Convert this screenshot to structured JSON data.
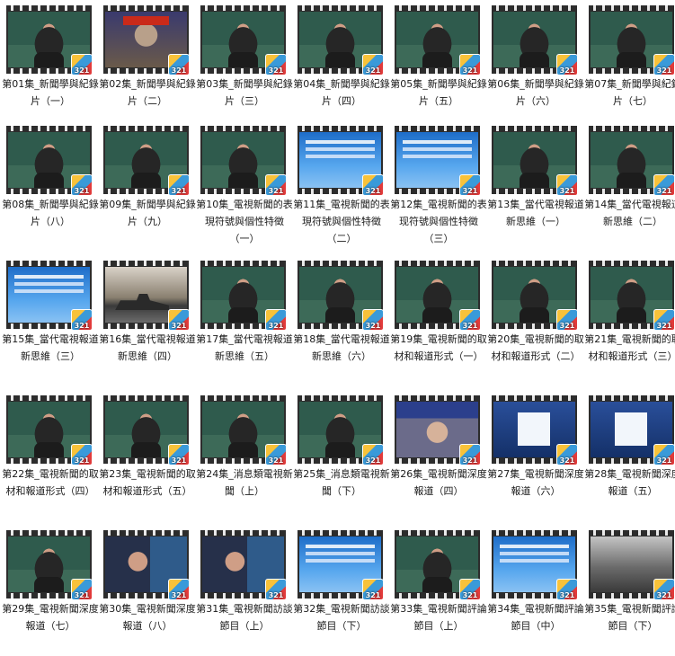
{
  "badge_text": "321",
  "items": [
    {
      "label": "第01集_新聞學與紀錄片（一）",
      "thumb": "lecture"
    },
    {
      "label": "第02集_新聞學與紀錄片（二）",
      "thumb": "book"
    },
    {
      "label": "第03集_新聞學與紀錄片（三）",
      "thumb": "lecture"
    },
    {
      "label": "第04集_新聞學與紀錄片（四）",
      "thumb": "lecture"
    },
    {
      "label": "第05集_新聞學與紀錄片（五）",
      "thumb": "lecture"
    },
    {
      "label": "第06集_新聞學與紀錄片（六）",
      "thumb": "lecture"
    },
    {
      "label": "第07集_新聞學與紀錄片（七）",
      "thumb": "lecture"
    },
    {
      "label": "第08集_新聞學與紀錄片（八）",
      "thumb": "lecture"
    },
    {
      "label": "第09集_新聞學與紀錄片（九）",
      "thumb": "lecture"
    },
    {
      "label": "第10集_電視新聞的表現符號與個性特徵（一）",
      "thumb": "lecture"
    },
    {
      "label": "第11集_電視新聞的表現符號與個性特徵（二）",
      "thumb": "blue"
    },
    {
      "label": "第12集_電視新聞的表现符號與個性特徵（三）",
      "thumb": "blue"
    },
    {
      "label": "第13集_當代電視報道新思維（一）",
      "thumb": "lecture"
    },
    {
      "label": "第14集_當代電視報道新思維（二）",
      "thumb": "lecture"
    },
    {
      "label": "第15集_當代電視報道新思維（三）",
      "thumb": "blue"
    },
    {
      "label": "第16集_當代電視報道新思維（四）",
      "thumb": "ship"
    },
    {
      "label": "第17集_當代電視報道新思維（五）",
      "thumb": "lecture"
    },
    {
      "label": "第18集_當代電視報道新思維（六）",
      "thumb": "lecture"
    },
    {
      "label": "第19集_電視新聞的取材和報道形式（一）",
      "thumb": "lecture"
    },
    {
      "label": "第20集_電視新聞的取材和報道形式（二）",
      "thumb": "lecture"
    },
    {
      "label": "第21集_電視新聞的取材和報道形式（三）",
      "thumb": "lecture"
    },
    {
      "label": "第22集_電視新聞的取材和報道形式（四）",
      "thumb": "lecture"
    },
    {
      "label": "第23集_電視新聞的取材和報道形式（五）",
      "thumb": "lecture"
    },
    {
      "label": "第24集_消息類電視新聞（上）",
      "thumb": "lecture"
    },
    {
      "label": "第25集_消息類電視新聞（下）",
      "thumb": "lecture"
    },
    {
      "label": "第26集_電視新聞深度報道（四）",
      "thumb": "news"
    },
    {
      "label": "第27集_電視新聞深度報道（六）",
      "thumb": "screen"
    },
    {
      "label": "第28集_電視新聞深度報道（五）",
      "thumb": "screen"
    },
    {
      "label": "第29集_電視新聞深度報道（七）",
      "thumb": "lecture"
    },
    {
      "label": "第30集_電視新聞深度報道（八）",
      "thumb": "talk"
    },
    {
      "label": "第31集_電視新聞訪談節目（上）",
      "thumb": "talk"
    },
    {
      "label": "第32集_電視新聞訪談節目（下）",
      "thumb": "blue"
    },
    {
      "label": "第33集_電視新聞評論節目（上）",
      "thumb": "lecture"
    },
    {
      "label": "第34集_電視新聞評論節目（中）",
      "thumb": "blue"
    },
    {
      "label": "第35集_電視新聞評論節目（下）",
      "thumb": "aerial"
    }
  ]
}
